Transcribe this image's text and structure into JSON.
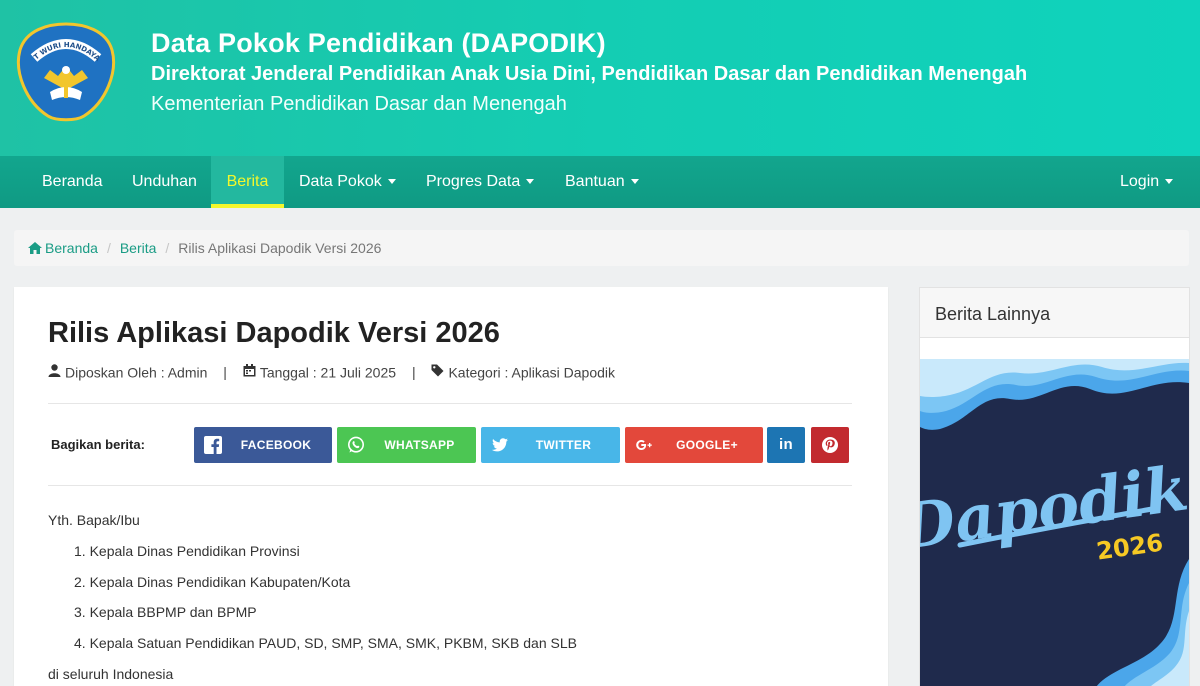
{
  "header": {
    "title": "Data Pokok Pendidikan (DAPODIK)",
    "subtitle": "Direktorat Jenderal Pendidikan Anak Usia Dini, Pendidikan Dasar dan Pendidikan Menengah",
    "ministry": "Kementerian Pendidikan Dasar dan Menengah",
    "logo_text": "TUT WURI HANDAYANI"
  },
  "nav": {
    "items": [
      {
        "label": "Beranda"
      },
      {
        "label": "Unduhan"
      },
      {
        "label": "Berita"
      },
      {
        "label": "Data Pokok"
      },
      {
        "label": "Progres Data"
      },
      {
        "label": "Bantuan"
      }
    ],
    "active": "Berita",
    "login": "Login"
  },
  "breadcrumb": {
    "home": "Beranda",
    "section": "Berita",
    "current": "Rilis Aplikasi Dapodik Versi 2026"
  },
  "article": {
    "title": "Rilis Aplikasi Dapodik Versi 2026",
    "author": "Diposkan Oleh : Admin",
    "date": "Tanggal : 21 Juli 2025",
    "category": "Kategori : Aplikasi Dapodik",
    "share_label": "Bagikan berita:",
    "greeting": "Yth. Bapak/Ibu",
    "recipients": [
      "1. Kepala Dinas Pendidikan Provinsi",
      "2. Kepala Dinas Pendidikan Kabupaten/Kota",
      "3. Kepala BBPMP dan BPMP",
      "4. Kepala Satuan Pendidikan PAUD, SD, SMP, SMA, SMK, PKBM, SKB dan SLB"
    ],
    "closing": "di seluruh Indonesia"
  },
  "share": {
    "facebook": "FACEBOOK",
    "whatsapp": "WHATSAPP",
    "twitter": "TWITTER",
    "google": "GOOGLE+",
    "linkedin": "in"
  },
  "sidebar": {
    "title": "Berita Lainnya",
    "banner_word": "Dapodik",
    "banner_year": "2026"
  },
  "colors": {
    "header": "#14cdb3",
    "nav": "#12a68e",
    "active_accent": "#f3f72c",
    "link": "#1a9c85"
  }
}
